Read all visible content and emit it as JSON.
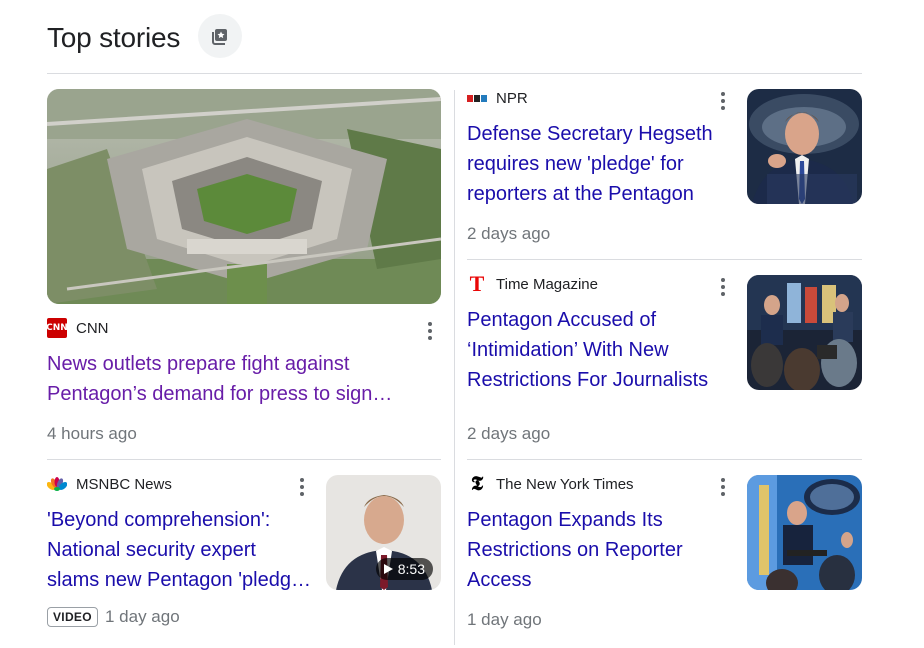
{
  "header": {
    "title": "Top stories",
    "icon": "bookmark-star-icon"
  },
  "stories": [
    {
      "source": "CNN",
      "logo": "cnn-logo",
      "headline_line1": "News outlets prepare fight against",
      "headline_line2": "Pentagon’s demand for press to sign…",
      "time": "4 hours ago",
      "visited": true
    },
    {
      "source": "NPR",
      "logo": "npr-logo",
      "headline_line1": "Defense Secretary Hegseth",
      "headline_line2": "requires new 'pledge' for",
      "headline_line3": "reporters at the Pentagon",
      "time": "2 days ago"
    },
    {
      "source": "Time Magazine",
      "logo": "time-logo",
      "headline_line1": "Pentagon Accused of",
      "headline_line2": "‘Intimidation’ With New",
      "headline_line3": "Restrictions For Journalists",
      "time": "2 days ago"
    },
    {
      "source": "MSNBC News",
      "logo": "msnbc-logo",
      "headline_line1": "'Beyond comprehension':",
      "headline_line2": "National security expert",
      "headline_line3": "slams new Pentagon 'pledge…",
      "badge": "VIDEO",
      "time": "1 day ago",
      "duration": "8:53"
    },
    {
      "source": "The New York Times",
      "logo": "nyt-logo",
      "headline_line1": "Pentagon Expands Its",
      "headline_line2": "Restrictions on Reporter",
      "headline_line3": "Access",
      "time": "1 day ago"
    }
  ],
  "colors": {
    "link": "#1a0dab",
    "visited": "#681da8",
    "meta": "#70757a",
    "divider": "#dadce0"
  }
}
